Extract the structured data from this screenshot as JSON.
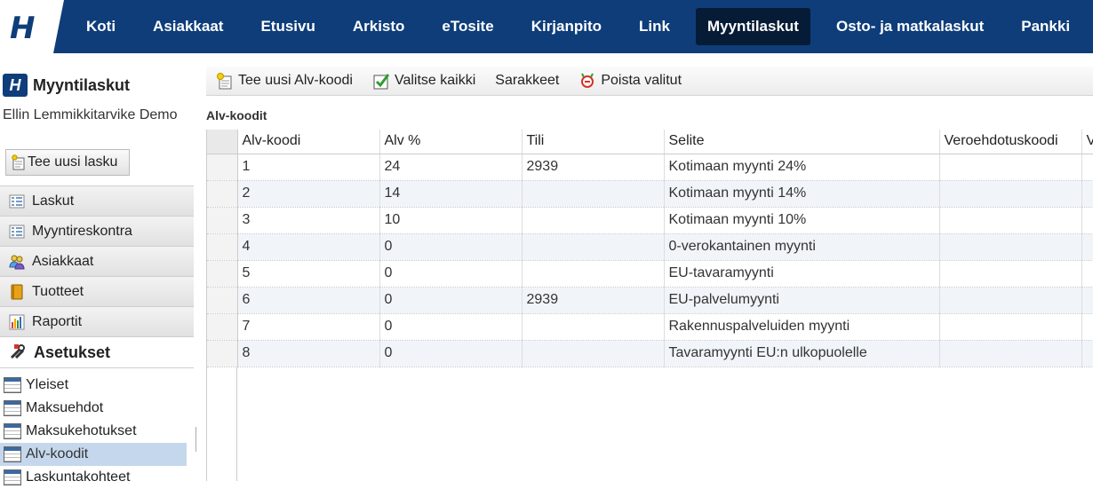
{
  "topbar": {
    "logo_text": "H",
    "nav": [
      {
        "label": "Koti"
      },
      {
        "label": "Asiakkaat"
      },
      {
        "label": "Etusivu"
      },
      {
        "label": "Arkisto"
      },
      {
        "label": "eTosite"
      },
      {
        "label": "Kirjanpito"
      },
      {
        "label": "Link"
      },
      {
        "label": "Myyntilaskut",
        "active": true
      },
      {
        "label": "Osto- ja matkalaskut"
      },
      {
        "label": "Pankki"
      }
    ]
  },
  "sidebar": {
    "logo_text": "H",
    "title": "Myyntilaskut",
    "company": "Ellin Lemmikkitarvike Demo",
    "new_invoice_label": "Tee uusi lasku",
    "menu": [
      {
        "label": "Laskut",
        "icon": "list-icon"
      },
      {
        "label": "Myyntireskontra",
        "icon": "ledger-icon"
      },
      {
        "label": "Asiakkaat",
        "icon": "people-icon"
      },
      {
        "label": "Tuotteet",
        "icon": "book-icon"
      },
      {
        "label": "Raportit",
        "icon": "bar-chart-icon"
      }
    ],
    "open_section": {
      "label": "Asetukset",
      "icon": "settings-tools-icon"
    },
    "sub_items": [
      {
        "label": "Yleiset"
      },
      {
        "label": "Maksuehdot"
      },
      {
        "label": "Maksukehotukset"
      },
      {
        "label": "Alv-koodit",
        "selected": true
      },
      {
        "label": "Laskuntakohteet"
      }
    ]
  },
  "toolbar": {
    "new_vat_code": "Tee uusi Alv-koodi",
    "select_all": "Valitse kaikki",
    "columns": "Sarakkeet",
    "delete_selected": "Poista valitut"
  },
  "section_title": "Alv-koodit",
  "table": {
    "columns": [
      "Alv-koodi",
      "Alv %",
      "Tili",
      "Selite",
      "Veroehdotuskoodi",
      "V"
    ],
    "rows": [
      [
        "1",
        "24",
        "2939",
        "Kotimaan myynti 24%",
        "",
        ""
      ],
      [
        "2",
        "14",
        "",
        "Kotimaan myynti 14%",
        "",
        ""
      ],
      [
        "3",
        "10",
        "",
        "Kotimaan myynti 10%",
        "",
        ""
      ],
      [
        "4",
        "0",
        "",
        "0-verokantainen myynti",
        "",
        ""
      ],
      [
        "5",
        "0",
        "",
        "EU-tavaramyynti",
        "",
        ""
      ],
      [
        "6",
        "0",
        "2939",
        "EU-palvelumyynti",
        "",
        ""
      ],
      [
        "7",
        "0",
        "",
        "Rakennuspalveluiden myynti",
        "",
        ""
      ],
      [
        "8",
        "0",
        "",
        "Tavaramyynti EU:n ulkopuolelle",
        "",
        ""
      ]
    ]
  },
  "colors": {
    "nav_bg": "#0e3d7a",
    "nav_active_bg": "#061b35",
    "selected_sub_item_bg": "#c5d7ec",
    "alt_row_bg": "#f1f5fa"
  }
}
